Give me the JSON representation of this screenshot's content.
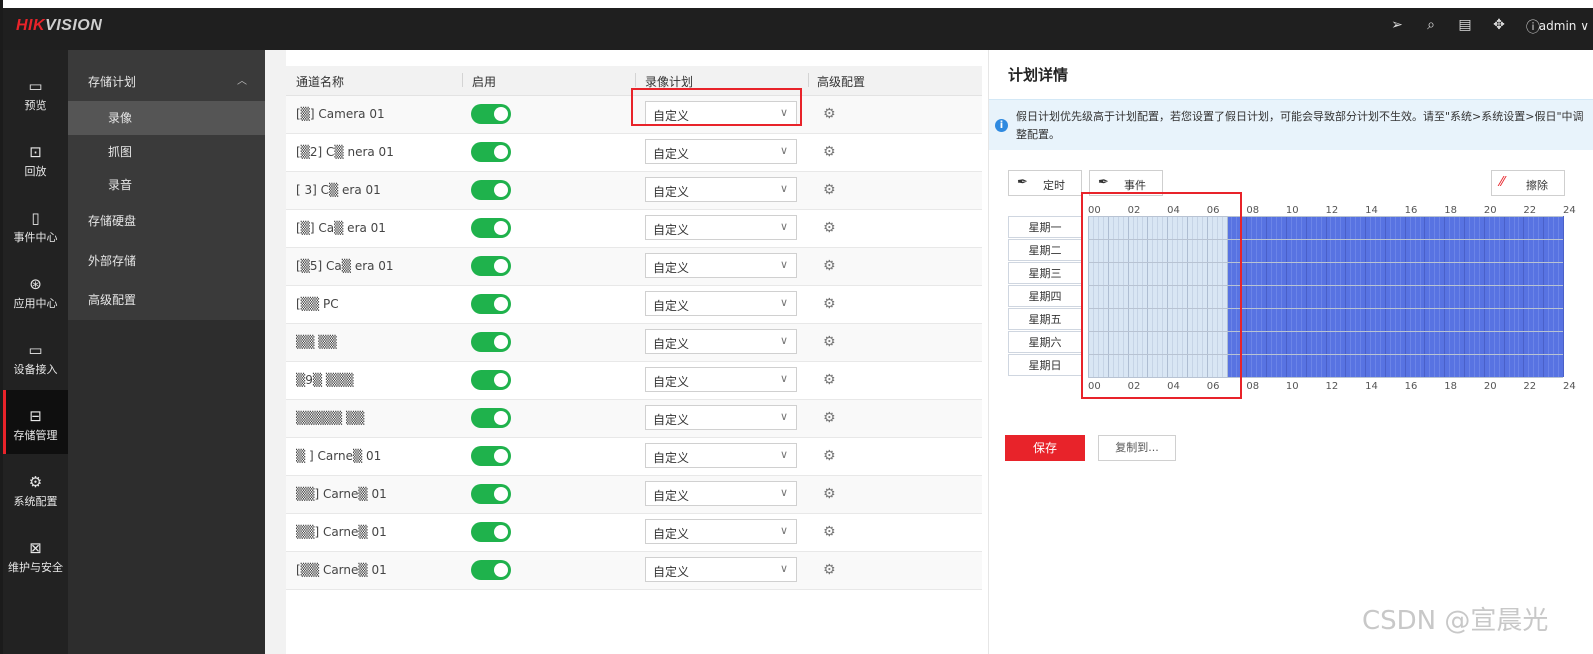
{
  "header": {
    "logo_red": "HIK",
    "logo_grey": "VISION",
    "user": "admin ∨",
    "icons": [
      "send-icon",
      "search-icon",
      "calendar-icon",
      "puzzle-icon",
      "info-icon"
    ]
  },
  "rail": [
    {
      "label": "预览",
      "icon": "preview-icon"
    },
    {
      "label": "回放",
      "icon": "playback-icon"
    },
    {
      "label": "事件中心",
      "icon": "event-icon"
    },
    {
      "label": "应用中心",
      "icon": "app-icon"
    },
    {
      "label": "设备接入",
      "icon": "device-icon"
    },
    {
      "label": "存储管理",
      "icon": "storage-icon",
      "active": true
    },
    {
      "label": "系统配置",
      "icon": "gear-icon"
    },
    {
      "label": "维护与安全",
      "icon": "maintenance-icon"
    }
  ],
  "submenu": {
    "group": "存储计划",
    "caret": "︿",
    "children": [
      "录像",
      "抓图",
      "录音"
    ],
    "items": [
      "存储硬盘",
      "外部存储",
      "高级配置"
    ]
  },
  "table": {
    "headers": [
      "通道名称",
      "启用",
      "录像计划",
      "高级配置"
    ],
    "rows": [
      {
        "name": "[▒] Camera 01",
        "plan": "自定义"
      },
      {
        "name": "[▒2] C▒ nera 01",
        "plan": "自定义"
      },
      {
        "name": "[ 3] C▒ era 01",
        "plan": "自定义"
      },
      {
        "name": "[▒] Ca▒ era 01",
        "plan": "自定义"
      },
      {
        "name": "[▒5] Ca▒ era 01",
        "plan": "自定义"
      },
      {
        "name": "[▒▒ PC",
        "plan": "自定义"
      },
      {
        "name": "▒▒ ▒▒",
        "plan": "自定义"
      },
      {
        "name": "▒9▒ ▒▒▒",
        "plan": "自定义"
      },
      {
        "name": "▒▒▒▒▒ ▒▒",
        "plan": "自定义"
      },
      {
        "name": "▒ ] Carne▒ 01",
        "plan": "自定义"
      },
      {
        "name": "▒▒] Carne▒ 01",
        "plan": "自定义"
      },
      {
        "name": "▒▒] Carne▒ 01",
        "plan": "自定义"
      },
      {
        "name": "[▒▒ Carne▒ 01",
        "plan": "自定义"
      }
    ]
  },
  "panel": {
    "title": "计划详情",
    "info": "假日计划优先级高于计划配置，若您设置了假日计划，可能会导致部分计划不生效。请至\"系统>系统设置>假日\"中调整配置。",
    "tool_timed": "定时",
    "tool_event": "事件",
    "tool_erase": "擦除",
    "days": [
      "星期一",
      "星期二",
      "星期三",
      "星期四",
      "星期五",
      "星期六",
      "星期日"
    ],
    "hours": [
      "00",
      "02",
      "04",
      "06",
      "08",
      "10",
      "12",
      "14",
      "16",
      "18",
      "20",
      "22",
      "24"
    ],
    "save": "保存",
    "copy": "复制到..."
  },
  "schedule": {
    "unscheduled_until_hour": 7,
    "scheduled_color": "#5873e2",
    "unscheduled_color": "#d9e6f4"
  },
  "watermark": "CSDN @宣晨光"
}
